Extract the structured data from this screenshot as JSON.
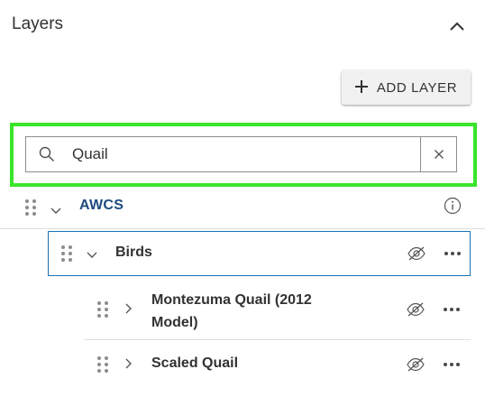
{
  "panel": {
    "title": "Layers",
    "collapse_icon": "chevron-up-icon"
  },
  "toolbar": {
    "add_layer_label": "ADD LAYER",
    "add_icon": "plus-icon"
  },
  "search": {
    "value": "Quail",
    "search_icon": "search-icon",
    "clear_icon": "close-icon",
    "highlight_color": "#39e52a"
  },
  "layers": {
    "root": {
      "label": "AWCS",
      "expanded": true,
      "info_icon": "info-icon",
      "color": "#1d4a7f"
    },
    "group": {
      "label": "Birds",
      "expanded": true,
      "visibility_icon": "eye-off-icon",
      "menu_icon": "more-icon",
      "selected_border": "#1a73b6"
    },
    "items": [
      {
        "label_line1": "Montezuma Quail (2012",
        "label_line2": "Model)",
        "expanded": false,
        "visibility_icon": "eye-off-icon",
        "menu_icon": "more-icon"
      },
      {
        "label_line1": "Scaled Quail",
        "label_line2": "",
        "expanded": false,
        "visibility_icon": "eye-off-icon",
        "menu_icon": "more-icon"
      }
    ]
  }
}
